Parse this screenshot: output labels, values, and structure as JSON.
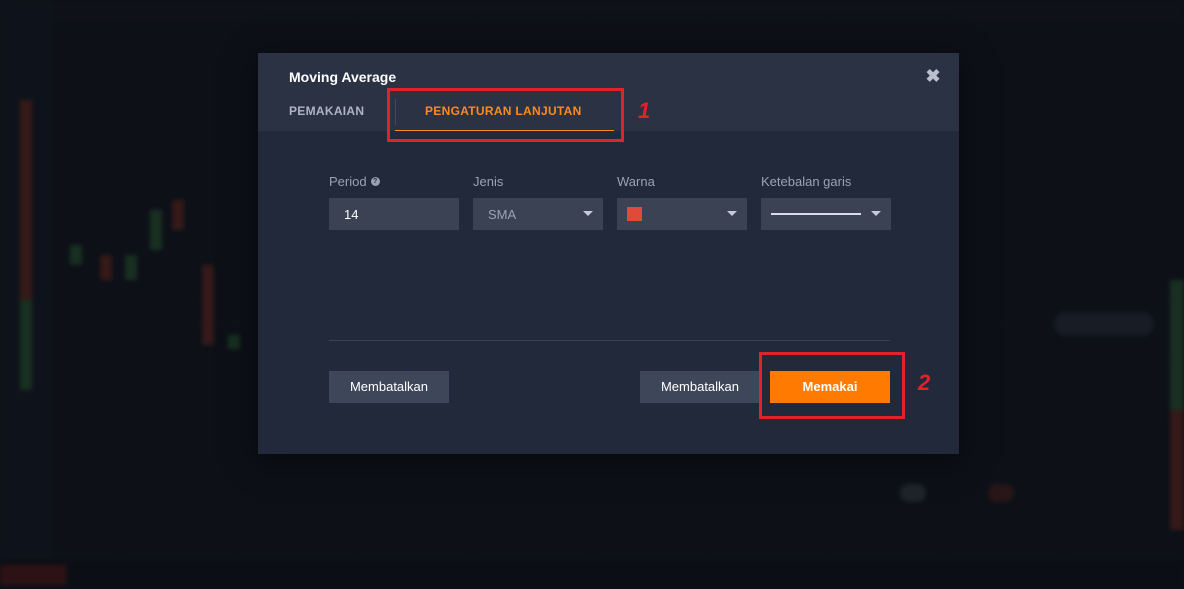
{
  "dialog": {
    "title": "Moving Average",
    "close_icon": "close-icon",
    "tabs": [
      {
        "label": "PEMAKAIAN",
        "active": false
      },
      {
        "label": "PENGATURAN LANJUTAN",
        "active": true
      }
    ],
    "fields": {
      "period": {
        "label": "Period",
        "value": "14",
        "help_icon": "help-icon"
      },
      "type": {
        "label": "Jenis",
        "value": "SMA"
      },
      "color": {
        "label": "Warna",
        "value": "#e04a39"
      },
      "line_width": {
        "label": "Ketebalan garis"
      }
    },
    "buttons": {
      "cancel_left": "Membatalkan",
      "cancel_right": "Membatalkan",
      "apply": "Memakai"
    }
  },
  "annotations": {
    "one": "1",
    "two": "2"
  },
  "colors": {
    "accent": "#ff8a1e",
    "apply_button": "#ff7a00",
    "annotation": "#e0222b"
  }
}
